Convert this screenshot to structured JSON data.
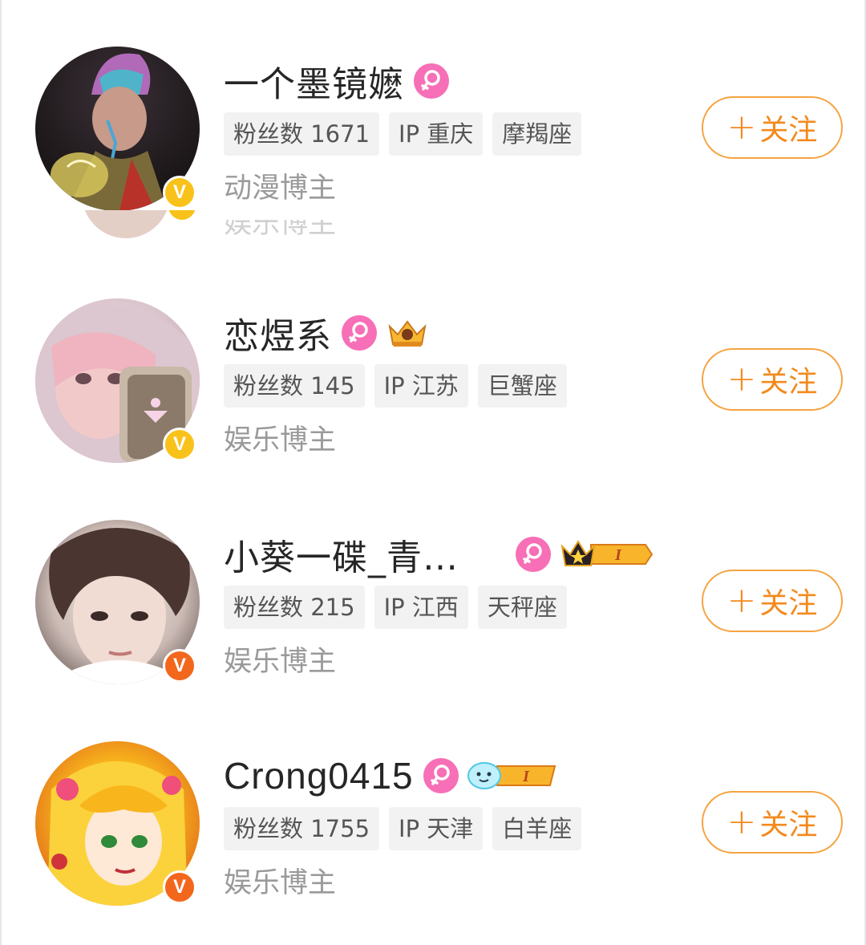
{
  "users": [
    {
      "name": "一个墨镜嬷",
      "tags": [
        "粉丝数 1671",
        "IP 重庆",
        "摩羯座"
      ],
      "role": "动漫博主",
      "follow_label": "关注",
      "badge_color": "#f9c21a"
    },
    {
      "name": "恋煜系",
      "tags": [
        "粉丝数 145",
        "IP 江苏",
        "巨蟹座"
      ],
      "role": "娱乐博主",
      "follow_label": "关注",
      "badge_color": "#f9c21a"
    },
    {
      "name": "小葵一碟_青…",
      "tags": [
        "粉丝数 215",
        "IP 江西",
        "天秤座"
      ],
      "role": "娱乐博主",
      "follow_label": "关注",
      "badge_color": "#f2671c"
    },
    {
      "name": "Crong0415",
      "tags": [
        "粉丝数 1755",
        "IP 天津",
        "白羊座"
      ],
      "role": "娱乐博主",
      "follow_label": "关注",
      "badge_color": "#f2671c"
    }
  ],
  "colors": {
    "accent": "#f38a1d",
    "gender_female": "#f76fb6",
    "tag_bg": "#f2f2f2"
  },
  "icons": {
    "gender": "female-icon",
    "verified": "verified-v-icon",
    "plus": "plus-icon"
  },
  "icon_glyphs": {
    "verified": "V",
    "plus": "+"
  },
  "level_badges": {
    "crown_level": "I",
    "cloud_level": "I"
  }
}
